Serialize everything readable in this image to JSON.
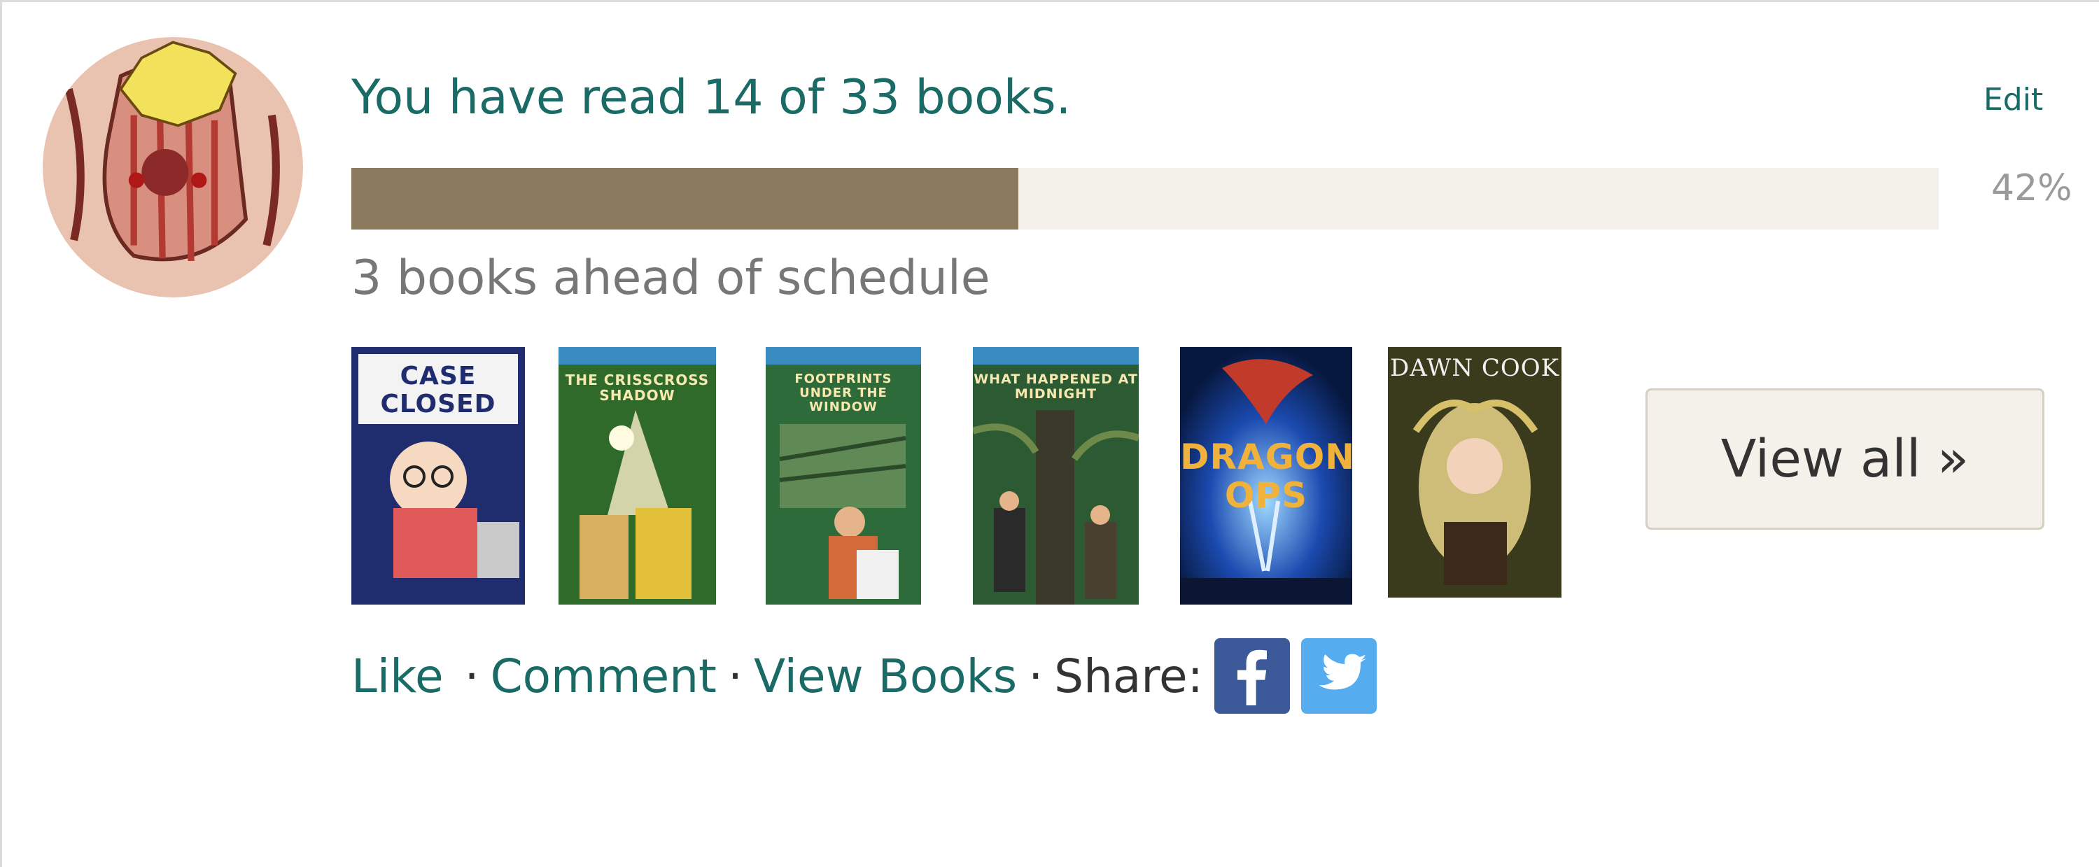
{
  "challenge": {
    "headline": "You have read 14 of 33 books.",
    "edit_label": "Edit",
    "progress_fraction": 0.42,
    "progress_label": "42%",
    "schedule_text": "3 books ahead of schedule",
    "view_all_label": "View all »"
  },
  "covers": [
    {
      "title": "CASE CLOSED",
      "bg": "#1f2c6e"
    },
    {
      "title": "THE CRISSCROSS SHADOW",
      "bg": "#2f6a2a"
    },
    {
      "title": "FOOTPRINTS UNDER THE WINDOW",
      "bg": "#2e6b3a"
    },
    {
      "title": "WHAT HAPPENED AT MIDNIGHT",
      "bg": "#2b5a33"
    },
    {
      "title": "DRAGON OPS",
      "bg": "#0d2a6e"
    },
    {
      "title": "DAWN COOK",
      "bg": "#3a3a1c"
    }
  ],
  "actions": {
    "like": "Like",
    "comment": "Comment",
    "view_books": "View Books",
    "share": "Share:"
  },
  "colors": {
    "link": "#1a6a66",
    "progress_fill": "#8c7a5e",
    "progress_track": "#f3f0e9",
    "facebook": "#3b5998",
    "twitter": "#55acee"
  }
}
